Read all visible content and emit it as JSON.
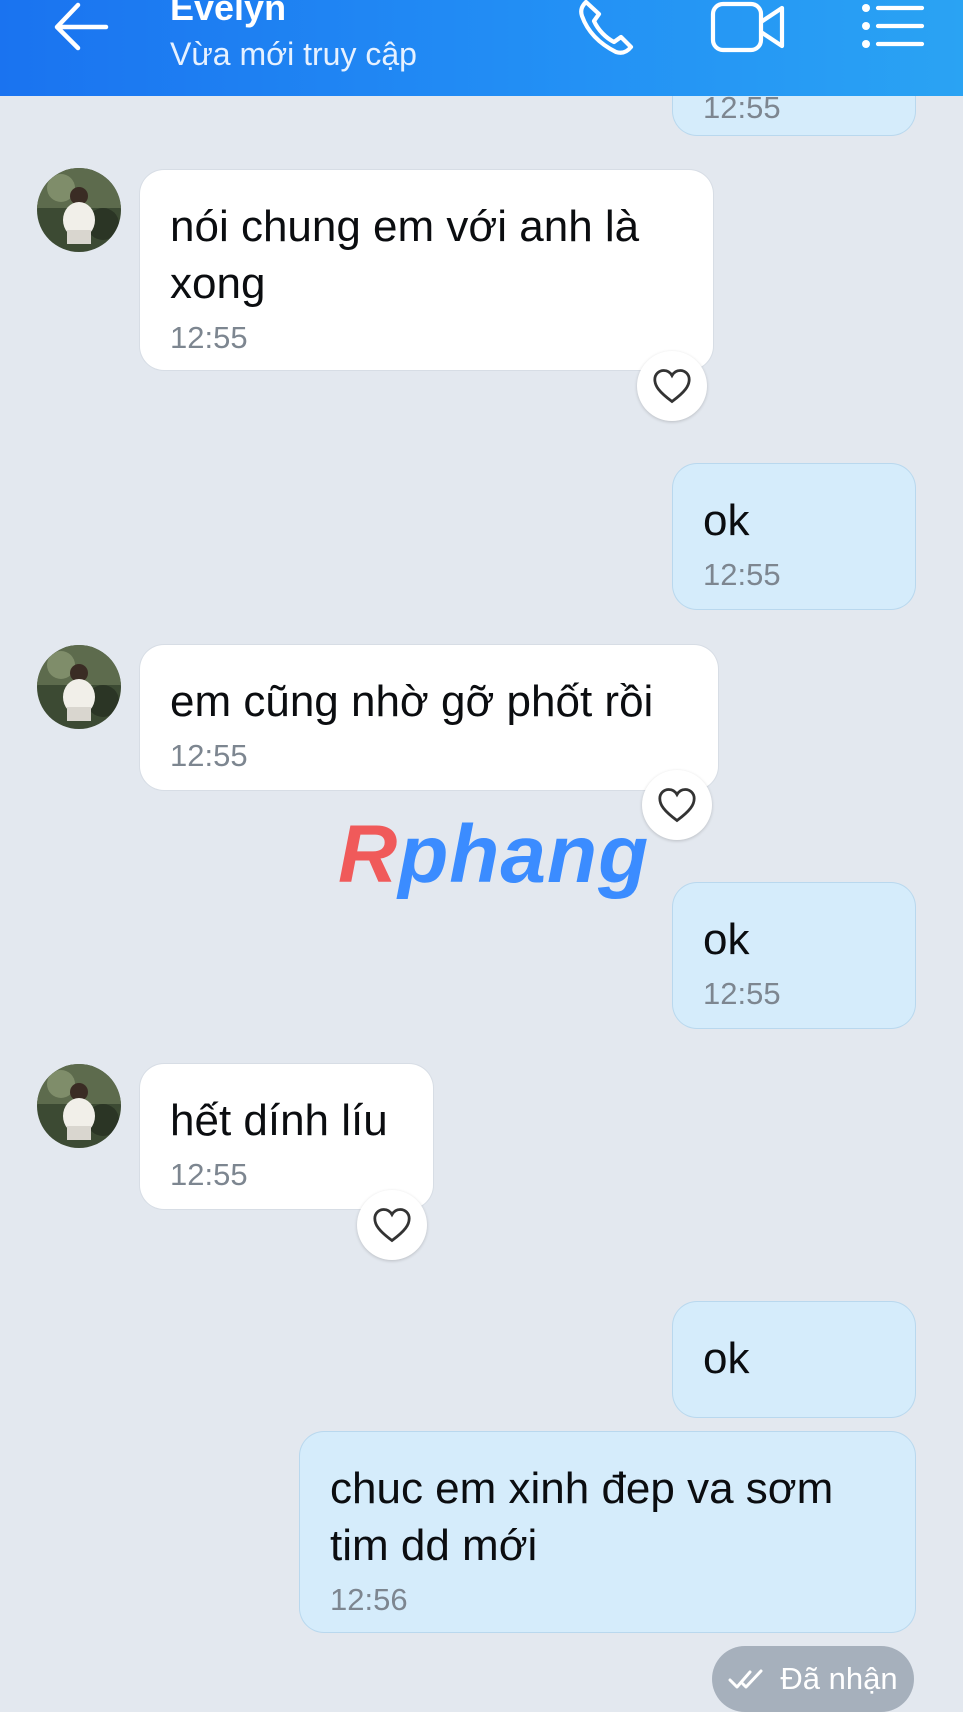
{
  "header": {
    "contact_name": "Evelyn",
    "status": "Vừa mới truy cập",
    "icons": [
      "back-arrow-icon",
      "phone-icon",
      "video-call-icon",
      "menu-list-icon"
    ]
  },
  "messages": [
    {
      "from": "me",
      "text": "",
      "time": "12:55"
    },
    {
      "from": "contact",
      "text": "nói chung em với anh là xong",
      "time": "12:55",
      "reaction": "heart"
    },
    {
      "from": "me",
      "text": "ok",
      "time": "12:55"
    },
    {
      "from": "contact",
      "text": "em cũng nhờ gỡ phốt rồi",
      "time": "12:55",
      "reaction": "heart"
    },
    {
      "from": "me",
      "text": "ok",
      "time": "12:55"
    },
    {
      "from": "contact",
      "text": "hết dính líu",
      "time": "12:55",
      "reaction": "heart"
    },
    {
      "from": "me",
      "text": "ok",
      "time": ""
    },
    {
      "from": "me",
      "text": "chuc em xinh đep va sơm tim dd mới",
      "time": "12:56"
    }
  ],
  "watermark": {
    "part1": "R",
    "part2": "phang"
  },
  "delivery_status": "Đã nhận",
  "colors": {
    "header": "#1a73f0",
    "outgoing_bubble": "#d5ecfb",
    "incoming_bubble": "#ffffff",
    "background": "#e3e8ef"
  }
}
